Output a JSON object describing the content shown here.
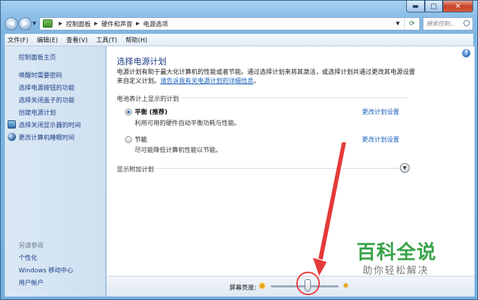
{
  "window": {
    "controls": {
      "minimize": "▬",
      "maximize": "□",
      "close": "✕"
    }
  },
  "address": {
    "crumbs": [
      "控制面板",
      "硬件和声音",
      "电源选项"
    ],
    "search_placeholder": "搜索控制...",
    "icons": {
      "back": "back-arrow-icon",
      "forward": "forward-arrow-icon",
      "refresh": "refresh-icon",
      "search": "search-icon"
    }
  },
  "menu": {
    "items": [
      "文件(F)",
      "编辑(E)",
      "查看(V)",
      "工具(T)",
      "帮助(H)"
    ]
  },
  "sidebar": {
    "home": "控制面板主页",
    "links": [
      "唤醒时需要密码",
      "选择电源按钮的功能",
      "选择关闭盖子的功能",
      "创建电源计划",
      "选择关闭显示器的时间",
      "更改计算机睡眠时间"
    ],
    "see_also_title": "另请参阅",
    "see_also": [
      "个性化",
      "Windows 移动中心",
      "用户帐户"
    ]
  },
  "main": {
    "title": "选择电源计划",
    "desc_line1": "电源计划有助于最大化计算机的性能或者节能。通过选择计划来将其激活，或选择计划并通过更改其电源设置",
    "desc_line2_prefix": "来自定义计划。",
    "desc_link": "请告诉我有关电源计划的详细信息",
    "desc_suffix": "。",
    "section_label": "电池表计上显示的计划",
    "plans": [
      {
        "name": "平衡 (推荐)",
        "desc": "利用可用的硬件自动平衡功耗与性能。",
        "link": "更改计划设置",
        "selected": true
      },
      {
        "name": "节能",
        "desc": "尽可能降低计算机性能以节能。",
        "link": "更改计划设置",
        "selected": false
      }
    ],
    "more_plans": "显示附加计划",
    "help": "?"
  },
  "brightness": {
    "label": "屏幕亮度:",
    "level_fraction": 0.55
  },
  "watermark": {
    "title": "百科全说",
    "subtitle": "助你轻松解决"
  },
  "colors": {
    "link": "#1a5fbd",
    "title": "#1e3b8a",
    "annotation": "#e53a3a",
    "watermark": "#3aa34a"
  }
}
